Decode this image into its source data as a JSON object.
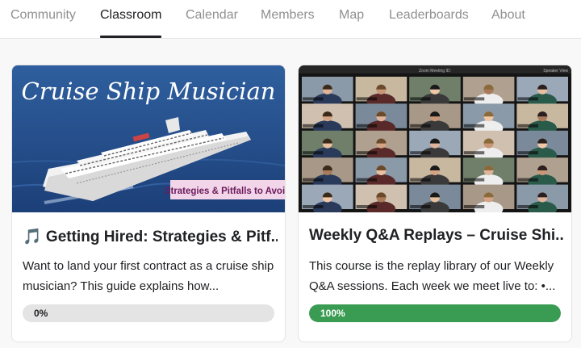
{
  "nav": {
    "tabs": [
      {
        "label": "Community"
      },
      {
        "label": "Classroom"
      },
      {
        "label": "Calendar"
      },
      {
        "label": "Members"
      },
      {
        "label": "Map"
      },
      {
        "label": "Leaderboards"
      },
      {
        "label": "About"
      }
    ],
    "active_tab": "Classroom"
  },
  "courses": [
    {
      "image": {
        "script_title": "Cruise Ship Musician",
        "banner": "Strategies & Pitfalls to Avoid"
      },
      "title": "🎵 Getting Hired: Strategies & Pitf...",
      "description": "Want to land your first contract as a cruise ship musician? This guide explains how...",
      "progress": 0,
      "progress_label": "0%",
      "progress_color": "#e4e4e4"
    },
    {
      "image": {
        "window_title": "Zoom Meeting ID:",
        "view_label": "Speaker View"
      },
      "title": "Weekly Q&A Replays – Cruise Shi...",
      "description": "This course is the replay library of our Weekly Q&A sessions. Each week we meet live to: •...",
      "progress": 1,
      "progress_label": "100%",
      "progress_color": "#3a9b52"
    }
  ],
  "colors": {
    "text": "#202124",
    "muted": "#909090",
    "success": "#3a9b52"
  }
}
